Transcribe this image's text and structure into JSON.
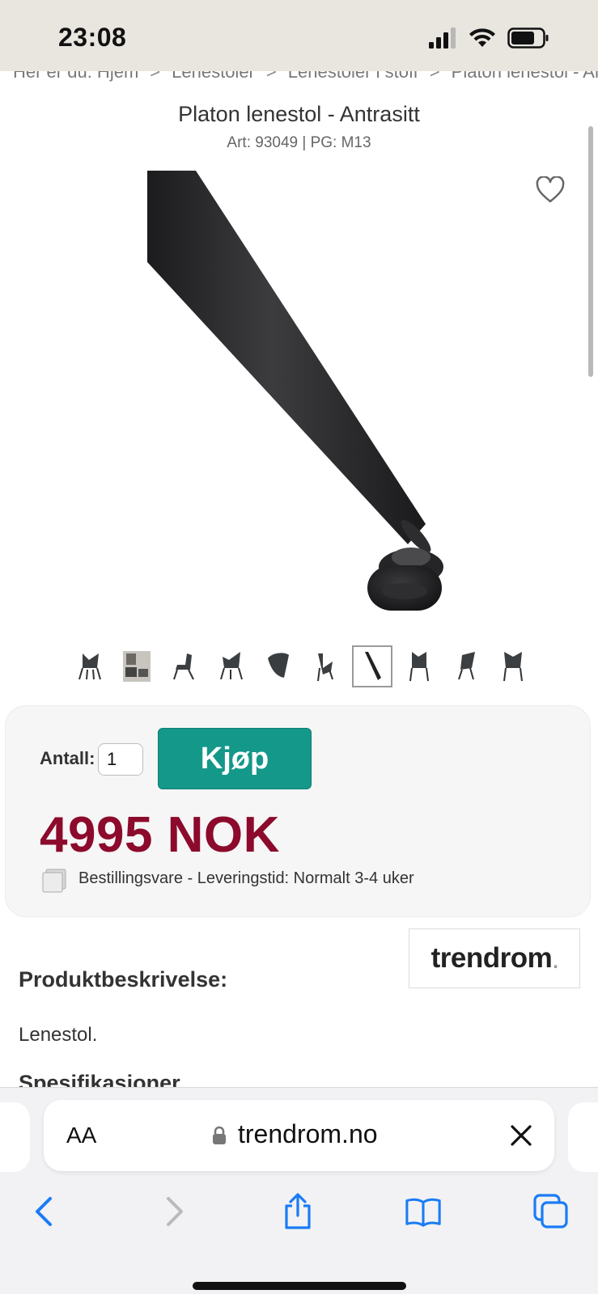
{
  "status_bar": {
    "time": "23:08"
  },
  "breadcrumb": [
    "Her er du: Hjem",
    "Lenestoler",
    "Lenestoler i stoff",
    "Platon lenestol - Antrasitt"
  ],
  "product": {
    "title": "Platon lenestol - Antrasitt",
    "subtitle": "Art: 93049 | PG: M13",
    "thumbnail_count": 10,
    "active_thumbnail": 7
  },
  "purchase": {
    "quantity_label": "Antall:",
    "quantity_value": "1",
    "buy_label": "Kjøp",
    "price": "4995 NOK",
    "delivery": "Bestillingsvare - Leveringstid: Normalt 3-4 uker"
  },
  "brand": {
    "name": "trendrom",
    "suffix": "."
  },
  "description": {
    "heading": "Produktbeskrivelse:",
    "text": "Lenestol.",
    "spec_heading": "Spesifikasjoner"
  },
  "browser": {
    "aa_label": "AA",
    "url": "trendrom.no"
  },
  "colors": {
    "status_bar_bg": "#e9e5df",
    "buy_button": "#14988a",
    "price": "#8c0a2c",
    "ios_blue": "#1a7cf5"
  }
}
